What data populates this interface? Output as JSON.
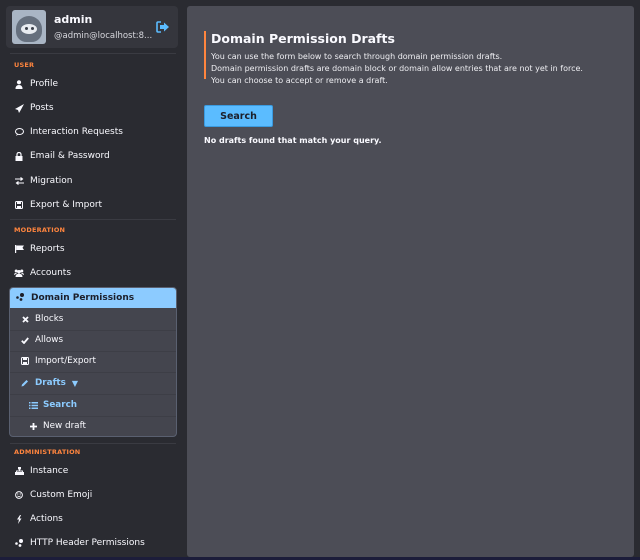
{
  "account": {
    "name": "admin",
    "handle": "@admin@localhost:8...",
    "avatar_icon": "sloth-avatar",
    "logout_icon": "logout-icon"
  },
  "sidebar": {
    "user_section": {
      "label": "USER",
      "items": [
        {
          "label": "Profile",
          "icon": "user-icon",
          "glyph": "👤"
        },
        {
          "label": "Posts",
          "icon": "paper-plane-icon",
          "glyph": "➤"
        },
        {
          "label": "Interaction Requests",
          "icon": "comment-icon",
          "glyph": "💬"
        },
        {
          "label": "Email & Password",
          "icon": "lock-icon",
          "glyph": "🔒"
        },
        {
          "label": "Migration",
          "icon": "exchange-icon",
          "glyph": "⇄"
        },
        {
          "label": "Export & Import",
          "icon": "floppy-icon",
          "glyph": "💾"
        }
      ]
    },
    "moderation_section": {
      "label": "MODERATION",
      "items": [
        {
          "label": "Reports",
          "icon": "flag-icon",
          "glyph": "⚑"
        },
        {
          "label": "Accounts",
          "icon": "users-icon",
          "glyph": "👥"
        }
      ],
      "group": {
        "label": "Domain Permissions",
        "icon": "nodes-icon",
        "items": [
          {
            "label": "Blocks",
            "icon": "times-icon",
            "glyph": "✖"
          },
          {
            "label": "Allows",
            "icon": "check-icon",
            "glyph": "✔"
          },
          {
            "label": "Import/Export",
            "icon": "floppy-icon",
            "glyph": "💾"
          },
          {
            "label": "Drafts",
            "icon": "pencil-icon",
            "glyph": "✎",
            "caret": "▼"
          },
          {
            "label": "Search",
            "icon": "list-icon",
            "glyph": "☰"
          },
          {
            "label": "New draft",
            "icon": "plus-icon",
            "glyph": "✚"
          }
        ]
      }
    },
    "administration_section": {
      "label": "ADMINISTRATION",
      "items": [
        {
          "label": "Instance",
          "icon": "sitemap-icon",
          "glyph": "品"
        },
        {
          "label": "Custom Emoji",
          "icon": "smile-icon",
          "glyph": "☺"
        },
        {
          "label": "Actions",
          "icon": "bolt-icon",
          "glyph": "ϟ"
        },
        {
          "label": "HTTP Header Permissions",
          "icon": "nodes-icon",
          "glyph": "⁘"
        }
      ]
    }
  },
  "main": {
    "title": "Domain Permission Drafts",
    "description": [
      "You can use the form below to search through domain permission drafts.",
      "Domain permission drafts are domain block or domain allow entries that are not yet in force.",
      "You can choose to accept or remove a draft."
    ],
    "search_button": "Search",
    "empty_message": "No drafts found that match your query."
  },
  "colors": {
    "accent_blue": "#8ccbff",
    "button_blue": "#5bbcff",
    "section_orange": "#ff853e",
    "background": "#2a2b31",
    "panel": "#4c4d56"
  }
}
